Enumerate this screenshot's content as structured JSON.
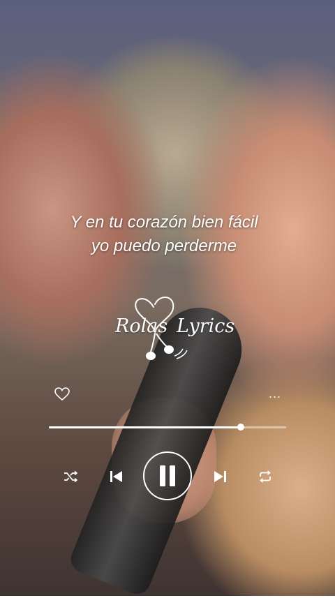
{
  "lyrics": {
    "line1": "Y en tu corazón bien fácil",
    "line2": "yo puedo perderme"
  },
  "logo": {
    "left_text": "Rolas",
    "right_text": "Lyrics"
  },
  "player": {
    "progress": 0.81,
    "like_icon": "heart-outline-icon",
    "more_label": "...",
    "controls": [
      "shuffle-icon",
      "previous-icon",
      "pause-icon",
      "next-icon",
      "repeat-icon"
    ]
  },
  "colors": {
    "accent": "#ffffff"
  }
}
